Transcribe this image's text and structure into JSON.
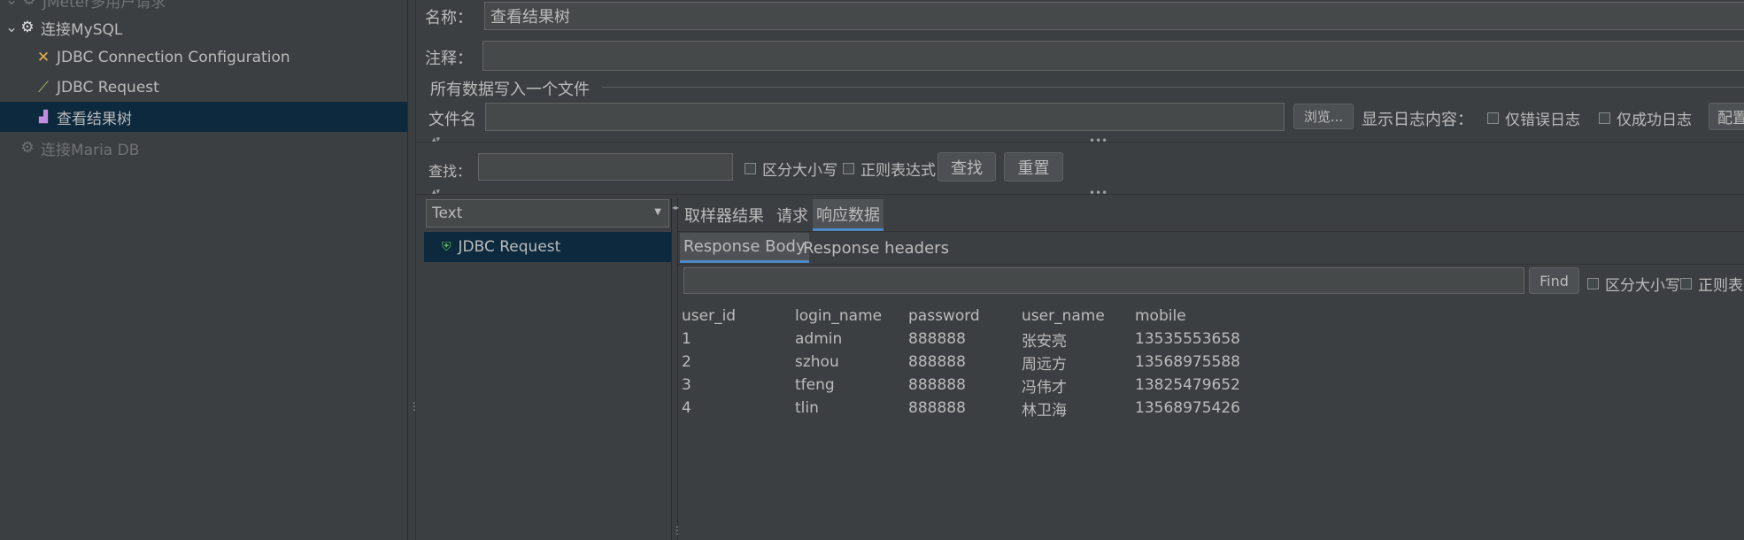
{
  "tree": {
    "top_partial": "JMeter多用户请求",
    "group_mysql": "连接MySQL",
    "jdbc_config": "JDBC Connection Configuration",
    "jdbc_request": "JDBC Request",
    "result_tree": "查看结果树",
    "group_maria": "连接Maria DB"
  },
  "form": {
    "name_label": "名称：",
    "name_value": "查看结果树",
    "comment_label": "注释：",
    "comment_value": "",
    "file_section_title": "所有数据写入一个文件",
    "filename_label": "文件名",
    "filename_value": "",
    "browse_button": "浏览...",
    "log_content_label": "显示日志内容：",
    "errors_only": "仅错误日志",
    "success_only": "仅成功日志",
    "configure_button": "配置"
  },
  "search": {
    "label": "查找：",
    "value": "",
    "case_sensitive": "区分大小写",
    "regex": "正则表达式",
    "find_button": "查找",
    "reset_button": "重置"
  },
  "results": {
    "renderer_select": "Text",
    "sample_item": "JDBC Request",
    "tabs": [
      "取样器结果",
      "请求",
      "响应数据"
    ],
    "active_tab": "响应数据",
    "subtabs": [
      "Response Body",
      "Response headers"
    ],
    "inner_find_button": "Find",
    "inner_case_sensitive": "区分大小写",
    "inner_regex": "正则表达式"
  },
  "response_table": {
    "headers": [
      "user_id",
      "login_name",
      "password",
      "user_name",
      "mobile"
    ],
    "rows": [
      [
        "1",
        "admin",
        "888888",
        "张安亮",
        "13535553658"
      ],
      [
        "2",
        "szhou",
        "888888",
        "周远方",
        "13568975588"
      ],
      [
        "3",
        "tfeng",
        "888888",
        "冯伟才",
        "13825479652"
      ],
      [
        "4",
        "tlin",
        "888888",
        "林卫海",
        "13568975426"
      ]
    ]
  }
}
